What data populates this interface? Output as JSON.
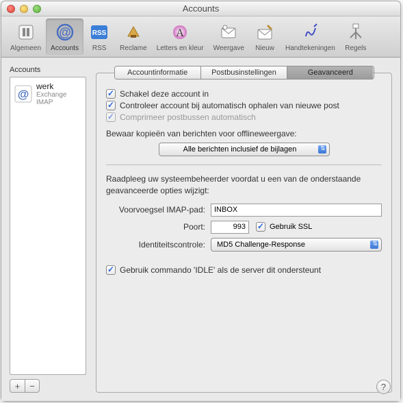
{
  "window": {
    "title": "Accounts"
  },
  "toolbar": {
    "general": "Algemeen",
    "accounts": "Accounts",
    "rss": "RSS",
    "reclame": "Reclame",
    "letters": "Letters en kleur",
    "weergave": "Weergave",
    "nieuw": "Nieuw",
    "handtekeningen": "Handtekeningen",
    "regels": "Regels"
  },
  "sidebar": {
    "label": "Accounts",
    "items": [
      {
        "name": "werk",
        "sub": "Exchange IMAP"
      }
    ],
    "plus": "+",
    "minus": "−"
  },
  "tabs": {
    "info": "Accountinformatie",
    "postbus": "Postbusinstellingen",
    "geavanceerd": "Geavanceerd"
  },
  "panel": {
    "enable": "Schakel deze account in",
    "check": "Controleer account bij automatisch ophalen van nieuwe post",
    "compress": "Comprimeer postbussen automatisch",
    "offlinelabel": "Bewaar kopieën van berichten voor offlineweergave:",
    "offlineopt": "Alle berichten inclusief de bijlagen",
    "note": "Raadpleeg uw systeembeheerder voordat u een van de onderstaande geavanceerde opties wijzigt:",
    "prefixlabel": "Voorvoegsel IMAP-pad:",
    "prefixval": "INBOX",
    "portlabel": "Poort:",
    "portval": "993",
    "ssl": "Gebruik SSL",
    "authlabel": "Identiteitscontrole:",
    "authval": "MD5 Challenge-Response",
    "idle": "Gebruik commando 'IDLE' als de server dit ondersteunt"
  },
  "help": "?"
}
